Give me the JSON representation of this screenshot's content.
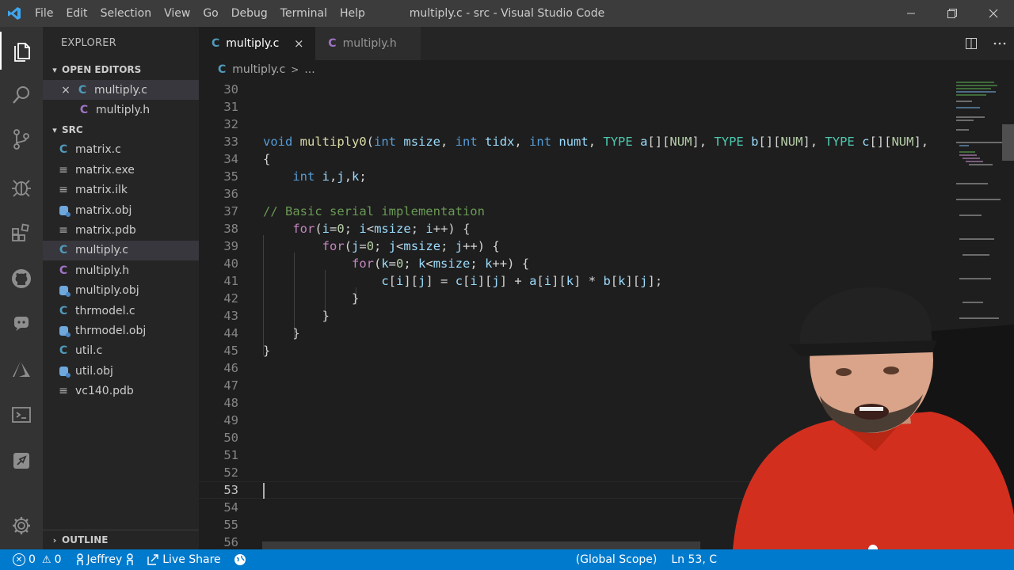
{
  "titlebar": {
    "menu": [
      "File",
      "Edit",
      "Selection",
      "View",
      "Go",
      "Debug",
      "Terminal",
      "Help"
    ],
    "window_title": "multiply.c - src - Visual Studio Code"
  },
  "activitybar": {
    "items": [
      "explorer-icon",
      "search-icon",
      "source-control-icon",
      "debug-icon",
      "extensions-icon",
      "github-icon",
      "discord-icon",
      "azure-icon",
      "terminal-icon",
      "remote-icon",
      "settings-gear-icon"
    ]
  },
  "sidebar": {
    "title": "EXPLORER",
    "open_editors_label": "OPEN EDITORS",
    "open_editors": [
      {
        "name": "multiply.c",
        "icon": "C",
        "close": "×"
      },
      {
        "name": "multiply.h",
        "icon": "C"
      }
    ],
    "folder_label": "SRC",
    "files": [
      {
        "name": "matrix.c",
        "icon": "C"
      },
      {
        "name": "matrix.exe",
        "icon": "≡"
      },
      {
        "name": "matrix.ilk",
        "icon": "≡"
      },
      {
        "name": "matrix.obj",
        "icon": "obj"
      },
      {
        "name": "matrix.pdb",
        "icon": "≡"
      },
      {
        "name": "multiply.c",
        "icon": "C"
      },
      {
        "name": "multiply.h",
        "icon": "C"
      },
      {
        "name": "multiply.obj",
        "icon": "obj"
      },
      {
        "name": "thrmodel.c",
        "icon": "C"
      },
      {
        "name": "thrmodel.obj",
        "icon": "obj"
      },
      {
        "name": "util.c",
        "icon": "C"
      },
      {
        "name": "util.obj",
        "icon": "obj"
      },
      {
        "name": "vc140.pdb",
        "icon": "≡"
      }
    ],
    "outline_label": "OUTLINE"
  },
  "tabs": [
    {
      "label": "multiply.c",
      "icon": "C",
      "close": "×"
    },
    {
      "label": "multiply.h",
      "icon": "C"
    }
  ],
  "breadcrumb": {
    "icon": "C",
    "file": "multiply.c",
    "sep": ">",
    "more": "..."
  },
  "editor": {
    "line_numbers": [
      "30",
      "31",
      "32",
      "33",
      "34",
      "35",
      "36",
      "37",
      "38",
      "39",
      "40",
      "41",
      "42",
      "43",
      "44",
      "45",
      "46",
      "47",
      "48",
      "49",
      "50",
      "51",
      "52",
      "53",
      "54",
      "55",
      "56"
    ],
    "current_line": "53",
    "code": {
      "l33": {
        "t1": "void",
        "t2": "multiply0",
        "t3": "(",
        "t4": "int",
        "t5": "msize",
        "t6": ", ",
        "t7": "int",
        "t8": "tidx",
        "t9": ", ",
        "t10": "int",
        "t11": "numt",
        "t12": ", ",
        "t13": "TYPE",
        "t14": "a",
        "t15": "[][",
        "t16": "NUM",
        "t17": "], ",
        "t18": "TYPE",
        "t19": "b",
        "t20": "[][",
        "t21": "NUM",
        "t22": "], ",
        "t23": "TYPE",
        "t24": "c",
        "t25": "[][",
        "t26": "NUM",
        "t27": "],"
      },
      "l34": "{",
      "l35": {
        "t1": "int",
        "t2": "i",
        "t3": ",",
        "t4": "j",
        "t5": ",",
        "t6": "k",
        "t7": ";"
      },
      "l37": "// Basic serial implementation",
      "l38": {
        "t1": "for",
        "t2": "(",
        "t3": "i",
        "t4": "=",
        "t5": "0",
        "t6": "; ",
        "t7": "i",
        "t8": "<",
        "t9": "msize",
        "t10": "; ",
        "t11": "i",
        "t12": "++) {"
      },
      "l39": {
        "t1": "for",
        "t2": "(",
        "t3": "j",
        "t4": "=",
        "t5": "0",
        "t6": "; ",
        "t7": "j",
        "t8": "<",
        "t9": "msize",
        "t10": "; ",
        "t11": "j",
        "t12": "++) {"
      },
      "l40": {
        "t1": "for",
        "t2": "(",
        "t3": "k",
        "t4": "=",
        "t5": "0",
        "t6": "; ",
        "t7": "k",
        "t8": "<",
        "t9": "msize",
        "t10": "; ",
        "t11": "k",
        "t12": "++) {"
      },
      "l41": {
        "t1": "c",
        "t2": "[",
        "t3": "i",
        "t4": "][",
        "t5": "j",
        "t6": "] = ",
        "t7": "c",
        "t8": "[",
        "t9": "i",
        "t10": "][",
        "t11": "j",
        "t12": "] + ",
        "t13": "a",
        "t14": "[",
        "t15": "i",
        "t16": "][",
        "t17": "k",
        "t18": "] * ",
        "t19": "b",
        "t20": "[",
        "t21": "k",
        "t22": "][",
        "t23": "j",
        "t24": "];"
      },
      "l42": "}",
      "l43": "}",
      "l44": "}",
      "l45": "}"
    }
  },
  "statusbar": {
    "errors": "0",
    "warnings": "0",
    "user": "Jeffrey",
    "live_share": "Live Share",
    "scope": "(Global Scope)",
    "position": "Ln 53, C"
  },
  "colors": {
    "accent": "#007acc",
    "keyword": "#569cd6",
    "control": "#c586c0",
    "function": "#dcdcaa",
    "variable": "#9cdcfe",
    "number": "#b5cea8",
    "comment": "#6a9955",
    "type_macro": "#4ec9b0"
  }
}
